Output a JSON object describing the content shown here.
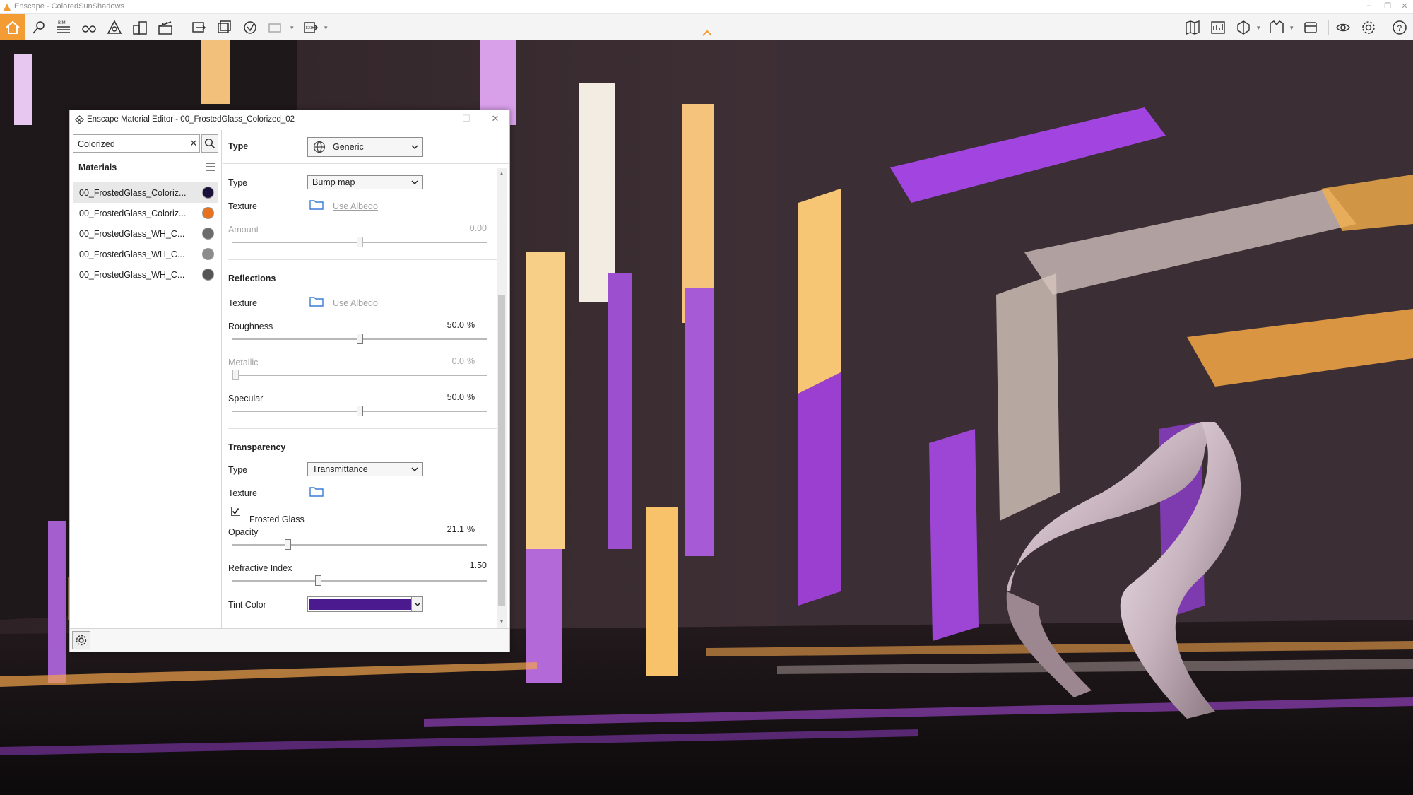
{
  "app": {
    "title": "Enscape - ColoredSunShadows",
    "accent": "#f39c33",
    "toolbar_left": [
      "home-icon",
      "location-pin-icon",
      "bim-icon",
      "binoculars-icon",
      "asset-library-icon",
      "buildings-icon",
      "clapper-icon",
      "screenshot-icon",
      "batch-render-icon",
      "upload-icon",
      "panorama-icon",
      "export-exe-icon"
    ],
    "toolbar_right": [
      "map-icon",
      "minimap-icon",
      "section-icon",
      "material-editor-icon",
      "views-icon",
      "visual-settings-icon",
      "settings-icon",
      "help-icon"
    ]
  },
  "editor": {
    "title": "Enscape Material Editor - 00_FrostedGlass_Colorized_02",
    "search": {
      "value": "Colorized",
      "clear": "✕"
    },
    "materials_label": "Materials",
    "materials": [
      {
        "name": "00_FrostedGlass_Coloriz...",
        "color": "#1a103a",
        "selected": true
      },
      {
        "name": "00_FrostedGlass_Coloriz...",
        "color": "#e8731f",
        "selected": false
      },
      {
        "name": "00_FrostedGlass_WH_C...",
        "color": "#6b6b6b",
        "selected": false
      },
      {
        "name": "00_FrostedGlass_WH_C...",
        "color": "#8c8c8c",
        "selected": false
      },
      {
        "name": "00_FrostedGlass_WH_C...",
        "color": "#555555",
        "selected": false
      }
    ],
    "type": {
      "label": "Type",
      "value": "Generic"
    },
    "bump": {
      "type_label": "Type",
      "type_value": "Bump map",
      "texture_label": "Texture",
      "texture_link": "Use Albedo",
      "amount_label": "Amount",
      "amount_value": "0.00",
      "amount_fraction": 0.5
    },
    "reflections": {
      "title": "Reflections",
      "texture_label": "Texture",
      "texture_link": "Use Albedo",
      "roughness_label": "Roughness",
      "roughness_value": "50.0",
      "roughness_unit": "%",
      "roughness_fraction": 0.5,
      "metallic_label": "Metallic",
      "metallic_value": "0.0",
      "metallic_unit": "%",
      "metallic_fraction": 0.0,
      "specular_label": "Specular",
      "specular_value": "50.0",
      "specular_unit": "%",
      "specular_fraction": 0.5
    },
    "transparency": {
      "title": "Transparency",
      "type_label": "Type",
      "type_value": "Transmittance",
      "texture_label": "Texture",
      "frosted_label": "Frosted Glass",
      "frosted_checked": true,
      "opacity_label": "Opacity",
      "opacity_value": "21.1",
      "opacity_unit": "%",
      "opacity_fraction": 0.211,
      "refractive_label": "Refractive Index",
      "refractive_value": "1.50",
      "refractive_fraction": 0.333,
      "tint_label": "Tint Color",
      "tint_color": "#4b1a8e"
    }
  }
}
